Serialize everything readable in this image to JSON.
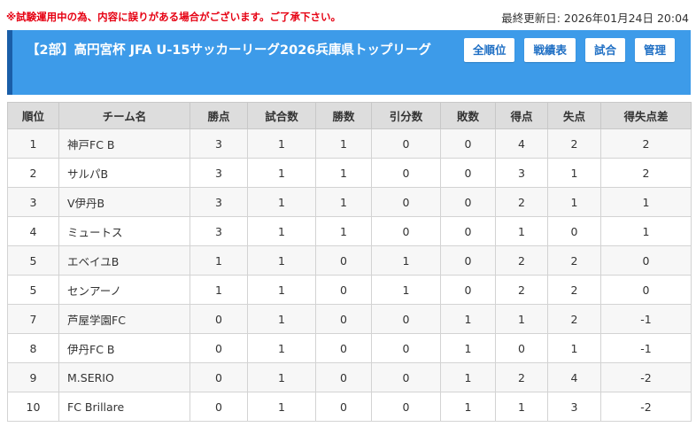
{
  "notice": "※試験運用中の為、内容に誤りがある場合がございます。ご了承下さい。",
  "updated": "最終更新日: 2026年01月24日 20:04",
  "header": {
    "title": "【2部】高円宮杯 JFA U-15サッカーリーグ2026兵庫県トップリーグ",
    "accent_color": "#3d9be9"
  },
  "nav": [
    {
      "label": "全順位"
    },
    {
      "label": "戦績表"
    },
    {
      "label": "試合"
    },
    {
      "label": "管理"
    }
  ],
  "table": {
    "columns": [
      "順位",
      "チーム名",
      "勝点",
      "試合数",
      "勝数",
      "引分数",
      "敗数",
      "得点",
      "失点",
      "得失点差"
    ],
    "rows": [
      [
        "1",
        "神戸FC B",
        "3",
        "1",
        "1",
        "0",
        "0",
        "4",
        "2",
        "2"
      ],
      [
        "2",
        "サルパB",
        "3",
        "1",
        "1",
        "0",
        "0",
        "3",
        "1",
        "2"
      ],
      [
        "3",
        "V伊丹B",
        "3",
        "1",
        "1",
        "0",
        "0",
        "2",
        "1",
        "1"
      ],
      [
        "4",
        "ミュートス",
        "3",
        "1",
        "1",
        "0",
        "0",
        "1",
        "0",
        "1"
      ],
      [
        "5",
        "エベイユB",
        "1",
        "1",
        "0",
        "1",
        "0",
        "2",
        "2",
        "0"
      ],
      [
        "5",
        "センアーノ",
        "1",
        "1",
        "0",
        "1",
        "0",
        "2",
        "2",
        "0"
      ],
      [
        "7",
        "芦屋学園FC",
        "0",
        "1",
        "0",
        "0",
        "1",
        "1",
        "2",
        "-1"
      ],
      [
        "8",
        "伊丹FC B",
        "0",
        "1",
        "0",
        "0",
        "1",
        "0",
        "1",
        "-1"
      ],
      [
        "9",
        "M.SERIO",
        "0",
        "1",
        "0",
        "0",
        "1",
        "2",
        "4",
        "-2"
      ],
      [
        "10",
        "FC Brillare",
        "0",
        "1",
        "0",
        "0",
        "1",
        "1",
        "3",
        "-2"
      ]
    ]
  }
}
